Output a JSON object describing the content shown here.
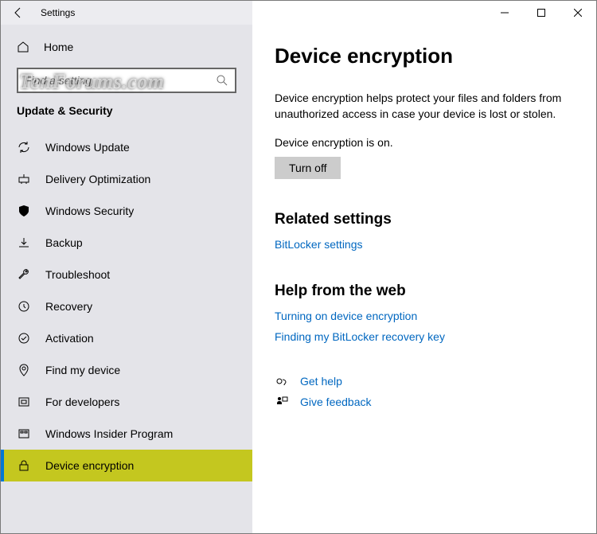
{
  "window": {
    "title": "Settings"
  },
  "watermark": "TenForums.com",
  "sidebar": {
    "home_label": "Home",
    "search_placeholder": "Find a setting",
    "section_header": "Update & Security",
    "items": [
      {
        "label": "Windows Update"
      },
      {
        "label": "Delivery Optimization"
      },
      {
        "label": "Windows Security"
      },
      {
        "label": "Backup"
      },
      {
        "label": "Troubleshoot"
      },
      {
        "label": "Recovery"
      },
      {
        "label": "Activation"
      },
      {
        "label": "Find my device"
      },
      {
        "label": "For developers"
      },
      {
        "label": "Windows Insider Program"
      },
      {
        "label": "Device encryption"
      }
    ]
  },
  "main": {
    "title": "Device encryption",
    "description": "Device encryption helps protect your files and folders from unauthorized access in case your device is lost or stolen.",
    "status": "Device encryption is on.",
    "button_label": "Turn off",
    "related_header": "Related settings",
    "related_link": "BitLocker settings",
    "help_header": "Help from the web",
    "help_links": [
      "Turning on device encryption",
      "Finding my BitLocker recovery key"
    ],
    "get_help": "Get help",
    "give_feedback": "Give feedback"
  }
}
